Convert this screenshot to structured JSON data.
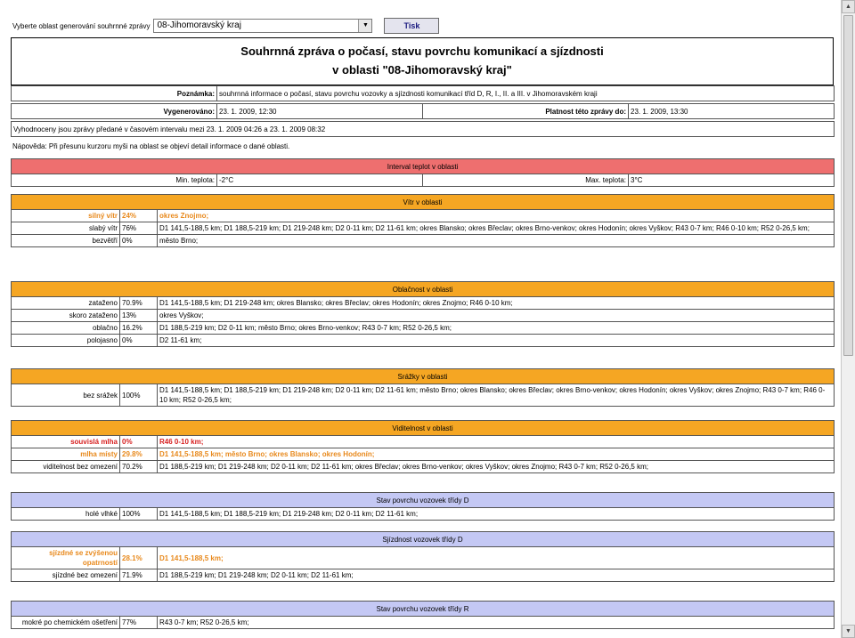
{
  "form": {
    "label": "Vyberte oblast generování souhrnné zprávy",
    "selected_region": "08-Jihomoravský kraj",
    "print_button": "Tisk"
  },
  "report": {
    "title_line1": "Souhrnná zpráva o počasí, stavu povrchu komunikací a sjízdnosti",
    "title_line2": "v oblasti \"08-Jihomoravský kraj\"",
    "note_label": "Poznámka:",
    "note_value": "souhrnná informace o počasí, stavu povrchu vozovky a sjízdnosti komunikací tříd D, R, I., II. a III. v Jihomoravském kraji",
    "generated_label": "Vygenerováno:",
    "generated_value": "23. 1. 2009, 12:30",
    "valid_label": "Platnost této zprávy do:",
    "valid_value": "23. 1. 2009, 13:30",
    "interval_text": "Vyhodnoceny jsou zprávy předané v časovém intervalu mezi 23. 1. 2009 04:26 a 23. 1. 2009 08:32",
    "hint": "Nápověda: Při přesunu kurzoru myši na oblast se objeví detail informace o dané oblasti."
  },
  "temperature": {
    "header": "Interval teplot v oblasti",
    "min_label": "Min. teplota:",
    "min_value": "-2°C",
    "max_label": "Max. teplota:",
    "max_value": "3°C"
  },
  "sections": [
    {
      "header": "Vítr v oblasti",
      "header_color": "#f5a623",
      "rows": [
        {
          "label": "silný vítr",
          "percent": "24%",
          "areas": "okres Znojmo;",
          "style": "warn"
        },
        {
          "label": "slabý vítr",
          "percent": "76%",
          "areas": "D1 141,5-188,5 km; D1 188,5-219 km; D1 219-248 km; D2 0-11 km; D2 11-61 km; okres Blansko; okres Břeclav; okres Brno-venkov; okres Hodonín; okres Vyškov; R43 0-7 km; R46 0-10 km; R52 0-26,5 km;",
          "style": "normal"
        },
        {
          "label": "bezvětří",
          "percent": "0%",
          "areas": "město Brno;",
          "style": "normal"
        }
      ]
    },
    {
      "header": "Oblačnost v oblasti",
      "header_color": "#f5a623",
      "rows": [
        {
          "label": "zataženo",
          "percent": "70.9%",
          "areas": "D1 141,5-188,5 km; D1 219-248 km; okres Blansko; okres Břeclav; okres Hodonín; okres Znojmo; R46 0-10 km;",
          "style": "normal"
        },
        {
          "label": "skoro zataženo",
          "percent": "13%",
          "areas": "okres Vyškov;",
          "style": "normal"
        },
        {
          "label": "oblačno",
          "percent": "16.2%",
          "areas": "D1 188,5-219 km; D2 0-11 km; město Brno; okres Brno-venkov; R43 0-7 km; R52 0-26,5 km;",
          "style": "normal"
        },
        {
          "label": "polojasno",
          "percent": "0%",
          "areas": "D2 11-61 km;",
          "style": "normal"
        }
      ]
    },
    {
      "header": "Srážky v oblasti",
      "header_color": "#f5a623",
      "rows": [
        {
          "label": "bez srážek",
          "percent": "100%",
          "areas": "D1 141,5-188,5 km; D1 188,5-219 km; D1 219-248 km; D2 0-11 km; D2 11-61 km; město Brno; okres Blansko; okres Břeclav; okres Brno-venkov; okres Hodonín; okres Vyškov; okres Znojmo; R43 0-7 km; R46 0-10 km; R52 0-26,5 km;",
          "style": "normal"
        }
      ]
    },
    {
      "header": "Viditelnost v oblasti",
      "header_color": "#f5a623",
      "rows": [
        {
          "label": "souvislá mlha",
          "percent": "0%",
          "areas": "R46 0-10 km;",
          "style": "alert"
        },
        {
          "label": "mlha místy",
          "percent": "29.8%",
          "areas": "D1 141,5-188,5 km; město Brno; okres Blansko; okres Hodonín;",
          "style": "warn"
        },
        {
          "label": "viditelnost bez omezení",
          "percent": "70.2%",
          "areas": "D1 188,5-219 km; D1 219-248 km; D2 0-11 km; D2 11-61 km; okres Břeclav; okres Brno-venkov; okres Vyškov; okres Znojmo; R43 0-7 km; R52 0-26,5 km;",
          "style": "normal"
        }
      ]
    },
    {
      "header": "Stav povrchu vozovek třídy D",
      "header_color": "#c4c8f4",
      "rows": [
        {
          "label": "holé vlhké",
          "percent": "100%",
          "areas": "D1 141,5-188,5 km; D1 188,5-219 km; D1 219-248 km; D2 0-11 km; D2 11-61 km;",
          "style": "normal"
        }
      ]
    },
    {
      "header": "Sjízdnost vozovek třídy D",
      "header_color": "#c4c8f4",
      "rows": [
        {
          "label": "sjízdné se zvýšenou opatrností",
          "percent": "28.1%",
          "areas": "D1 141,5-188,5 km;",
          "style": "warn"
        },
        {
          "label": "sjízdné bez omezení",
          "percent": "71.9%",
          "areas": "D1 188,5-219 km; D1 219-248 km; D2 0-11 km; D2 11-61 km;",
          "style": "normal"
        }
      ]
    },
    {
      "header": "Stav povrchu vozovek třídy R",
      "header_color": "#c4c8f4",
      "rows": [
        {
          "label": "mokré po chemickém ošetření",
          "percent": "77%",
          "areas": "R43 0-7 km; R52 0-26,5 km;",
          "style": "normal"
        }
      ]
    }
  ]
}
